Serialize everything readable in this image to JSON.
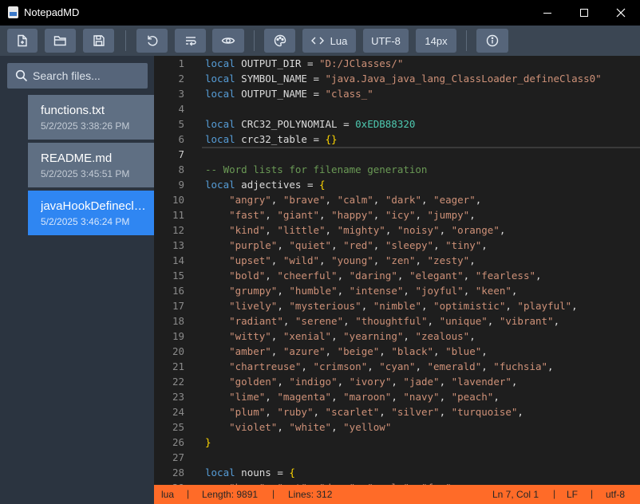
{
  "window": {
    "title": "NotepadMD"
  },
  "toolbar": {
    "buttons": [
      {
        "icon": "new-file-icon"
      },
      {
        "icon": "open-folder-icon"
      },
      {
        "icon": "save-icon"
      },
      {
        "icon": "reload-icon"
      },
      {
        "icon": "word-wrap-icon"
      },
      {
        "icon": "eye-icon"
      },
      {
        "icon": "palette-icon"
      },
      {
        "icon": "code-icon",
        "label": "Lua"
      },
      {
        "label": "UTF-8"
      },
      {
        "label": "14px"
      },
      {
        "icon": "info-icon"
      }
    ]
  },
  "sidebar": {
    "search_placeholder": "Search files...",
    "files": [
      {
        "name": "functions.txt",
        "date": "5/2/2025 3:38:26 PM",
        "active": false
      },
      {
        "name": "README.md",
        "date": "5/2/2025 3:45:51 PM",
        "active": false
      },
      {
        "name": "javaHookDefineclass.lua",
        "date": "5/2/2025 3:46:24 PM",
        "active": true
      }
    ]
  },
  "editor": {
    "current_line": 7,
    "lines": [
      [
        [
          "kw",
          "local"
        ],
        [
          "t",
          " OUTPUT_DIR = "
        ],
        [
          "str",
          "\"D:/JClasses/\""
        ]
      ],
      [
        [
          "kw",
          "local"
        ],
        [
          "t",
          " SYMBOL_NAME = "
        ],
        [
          "str",
          "\"java.Java_java_lang_ClassLoader_defineClass0\""
        ]
      ],
      [
        [
          "kw",
          "local"
        ],
        [
          "t",
          " OUTPUT_NAME = "
        ],
        [
          "str",
          "\"class_\""
        ]
      ],
      [],
      [
        [
          "kw",
          "local"
        ],
        [
          "t",
          " CRC32_POLYNOMIAL = "
        ],
        [
          "num",
          "0xEDB88320"
        ]
      ],
      [
        [
          "kw",
          "local"
        ],
        [
          "t",
          " crc32_table = "
        ],
        [
          "br",
          "{}"
        ]
      ],
      [],
      [
        [
          "cm",
          "-- Word lists for filename generation"
        ]
      ],
      [
        [
          "kw",
          "local"
        ],
        [
          "t",
          " adjectives = "
        ],
        [
          "br",
          "{"
        ]
      ],
      [
        [
          "t",
          "    "
        ],
        [
          "str",
          "\"angry\""
        ],
        [
          "t",
          ", "
        ],
        [
          "str",
          "\"brave\""
        ],
        [
          "t",
          ", "
        ],
        [
          "str",
          "\"calm\""
        ],
        [
          "t",
          ", "
        ],
        [
          "str",
          "\"dark\""
        ],
        [
          "t",
          ", "
        ],
        [
          "str",
          "\"eager\""
        ],
        [
          "t",
          ","
        ]
      ],
      [
        [
          "t",
          "    "
        ],
        [
          "str",
          "\"fast\""
        ],
        [
          "t",
          ", "
        ],
        [
          "str",
          "\"giant\""
        ],
        [
          "t",
          ", "
        ],
        [
          "str",
          "\"happy\""
        ],
        [
          "t",
          ", "
        ],
        [
          "str",
          "\"icy\""
        ],
        [
          "t",
          ", "
        ],
        [
          "str",
          "\"jumpy\""
        ],
        [
          "t",
          ","
        ]
      ],
      [
        [
          "t",
          "    "
        ],
        [
          "str",
          "\"kind\""
        ],
        [
          "t",
          ", "
        ],
        [
          "str",
          "\"little\""
        ],
        [
          "t",
          ", "
        ],
        [
          "str",
          "\"mighty\""
        ],
        [
          "t",
          ", "
        ],
        [
          "str",
          "\"noisy\""
        ],
        [
          "t",
          ", "
        ],
        [
          "str",
          "\"orange\""
        ],
        [
          "t",
          ","
        ]
      ],
      [
        [
          "t",
          "    "
        ],
        [
          "str",
          "\"purple\""
        ],
        [
          "t",
          ", "
        ],
        [
          "str",
          "\"quiet\""
        ],
        [
          "t",
          ", "
        ],
        [
          "str",
          "\"red\""
        ],
        [
          "t",
          ", "
        ],
        [
          "str",
          "\"sleepy\""
        ],
        [
          "t",
          ", "
        ],
        [
          "str",
          "\"tiny\""
        ],
        [
          "t",
          ","
        ]
      ],
      [
        [
          "t",
          "    "
        ],
        [
          "str",
          "\"upset\""
        ],
        [
          "t",
          ", "
        ],
        [
          "str",
          "\"wild\""
        ],
        [
          "t",
          ", "
        ],
        [
          "str",
          "\"young\""
        ],
        [
          "t",
          ", "
        ],
        [
          "str",
          "\"zen\""
        ],
        [
          "t",
          ", "
        ],
        [
          "str",
          "\"zesty\""
        ],
        [
          "t",
          ","
        ]
      ],
      [
        [
          "t",
          "    "
        ],
        [
          "str",
          "\"bold\""
        ],
        [
          "t",
          ", "
        ],
        [
          "str",
          "\"cheerful\""
        ],
        [
          "t",
          ", "
        ],
        [
          "str",
          "\"daring\""
        ],
        [
          "t",
          ", "
        ],
        [
          "str",
          "\"elegant\""
        ],
        [
          "t",
          ", "
        ],
        [
          "str",
          "\"fearless\""
        ],
        [
          "t",
          ","
        ]
      ],
      [
        [
          "t",
          "    "
        ],
        [
          "str",
          "\"grumpy\""
        ],
        [
          "t",
          ", "
        ],
        [
          "str",
          "\"humble\""
        ],
        [
          "t",
          ", "
        ],
        [
          "str",
          "\"intense\""
        ],
        [
          "t",
          ", "
        ],
        [
          "str",
          "\"joyful\""
        ],
        [
          "t",
          ", "
        ],
        [
          "str",
          "\"keen\""
        ],
        [
          "t",
          ","
        ]
      ],
      [
        [
          "t",
          "    "
        ],
        [
          "str",
          "\"lively\""
        ],
        [
          "t",
          ", "
        ],
        [
          "str",
          "\"mysterious\""
        ],
        [
          "t",
          ", "
        ],
        [
          "str",
          "\"nimble\""
        ],
        [
          "t",
          ", "
        ],
        [
          "str",
          "\"optimistic\""
        ],
        [
          "t",
          ", "
        ],
        [
          "str",
          "\"playful\""
        ],
        [
          "t",
          ","
        ]
      ],
      [
        [
          "t",
          "    "
        ],
        [
          "str",
          "\"radiant\""
        ],
        [
          "t",
          ", "
        ],
        [
          "str",
          "\"serene\""
        ],
        [
          "t",
          ", "
        ],
        [
          "str",
          "\"thoughtful\""
        ],
        [
          "t",
          ", "
        ],
        [
          "str",
          "\"unique\""
        ],
        [
          "t",
          ", "
        ],
        [
          "str",
          "\"vibrant\""
        ],
        [
          "t",
          ","
        ]
      ],
      [
        [
          "t",
          "    "
        ],
        [
          "str",
          "\"witty\""
        ],
        [
          "t",
          ", "
        ],
        [
          "str",
          "\"xenial\""
        ],
        [
          "t",
          ", "
        ],
        [
          "str",
          "\"yearning\""
        ],
        [
          "t",
          ", "
        ],
        [
          "str",
          "\"zealous\""
        ],
        [
          "t",
          ","
        ]
      ],
      [
        [
          "t",
          "    "
        ],
        [
          "str",
          "\"amber\""
        ],
        [
          "t",
          ", "
        ],
        [
          "str",
          "\"azure\""
        ],
        [
          "t",
          ", "
        ],
        [
          "str",
          "\"beige\""
        ],
        [
          "t",
          ", "
        ],
        [
          "str",
          "\"black\""
        ],
        [
          "t",
          ", "
        ],
        [
          "str",
          "\"blue\""
        ],
        [
          "t",
          ","
        ]
      ],
      [
        [
          "t",
          "    "
        ],
        [
          "str",
          "\"chartreuse\""
        ],
        [
          "t",
          ", "
        ],
        [
          "str",
          "\"crimson\""
        ],
        [
          "t",
          ", "
        ],
        [
          "str",
          "\"cyan\""
        ],
        [
          "t",
          ", "
        ],
        [
          "str",
          "\"emerald\""
        ],
        [
          "t",
          ", "
        ],
        [
          "str",
          "\"fuchsia\""
        ],
        [
          "t",
          ","
        ]
      ],
      [
        [
          "t",
          "    "
        ],
        [
          "str",
          "\"golden\""
        ],
        [
          "t",
          ", "
        ],
        [
          "str",
          "\"indigo\""
        ],
        [
          "t",
          ", "
        ],
        [
          "str",
          "\"ivory\""
        ],
        [
          "t",
          ", "
        ],
        [
          "str",
          "\"jade\""
        ],
        [
          "t",
          ", "
        ],
        [
          "str",
          "\"lavender\""
        ],
        [
          "t",
          ","
        ]
      ],
      [
        [
          "t",
          "    "
        ],
        [
          "str",
          "\"lime\""
        ],
        [
          "t",
          ", "
        ],
        [
          "str",
          "\"magenta\""
        ],
        [
          "t",
          ", "
        ],
        [
          "str",
          "\"maroon\""
        ],
        [
          "t",
          ", "
        ],
        [
          "str",
          "\"navy\""
        ],
        [
          "t",
          ", "
        ],
        [
          "str",
          "\"peach\""
        ],
        [
          "t",
          ","
        ]
      ],
      [
        [
          "t",
          "    "
        ],
        [
          "str",
          "\"plum\""
        ],
        [
          "t",
          ", "
        ],
        [
          "str",
          "\"ruby\""
        ],
        [
          "t",
          ", "
        ],
        [
          "str",
          "\"scarlet\""
        ],
        [
          "t",
          ", "
        ],
        [
          "str",
          "\"silver\""
        ],
        [
          "t",
          ", "
        ],
        [
          "str",
          "\"turquoise\""
        ],
        [
          "t",
          ","
        ]
      ],
      [
        [
          "t",
          "    "
        ],
        [
          "str",
          "\"violet\""
        ],
        [
          "t",
          ", "
        ],
        [
          "str",
          "\"white\""
        ],
        [
          "t",
          ", "
        ],
        [
          "str",
          "\"yellow\""
        ]
      ],
      [
        [
          "br",
          "}"
        ]
      ],
      [],
      [
        [
          "kw",
          "local"
        ],
        [
          "t",
          " nouns = "
        ],
        [
          "br",
          "{"
        ]
      ],
      [
        [
          "t",
          "    "
        ],
        [
          "str",
          "\"bear\""
        ],
        [
          "t",
          ", "
        ],
        [
          "str",
          "\"cat\""
        ],
        [
          "t",
          ", "
        ],
        [
          "str",
          "\"deer\""
        ],
        [
          "t",
          ", "
        ],
        [
          "str",
          "\"eagle\""
        ],
        [
          "t",
          ", "
        ],
        [
          "str",
          "\"fox\""
        ],
        [
          "t",
          ","
        ]
      ]
    ]
  },
  "statusbar": {
    "language": "lua",
    "length": "Length: 9891",
    "lines": "Lines: 312",
    "position": "Ln 7, Col 1",
    "eol": "LF",
    "encoding": "utf-8"
  },
  "colors": {
    "accent": "#2f86f2",
    "status": "#ff6b28",
    "keyword": "#569cd6",
    "string": "#ce9178",
    "number": "#4ec9b0",
    "comment": "#6a9955",
    "bracket": "#ffd700"
  }
}
